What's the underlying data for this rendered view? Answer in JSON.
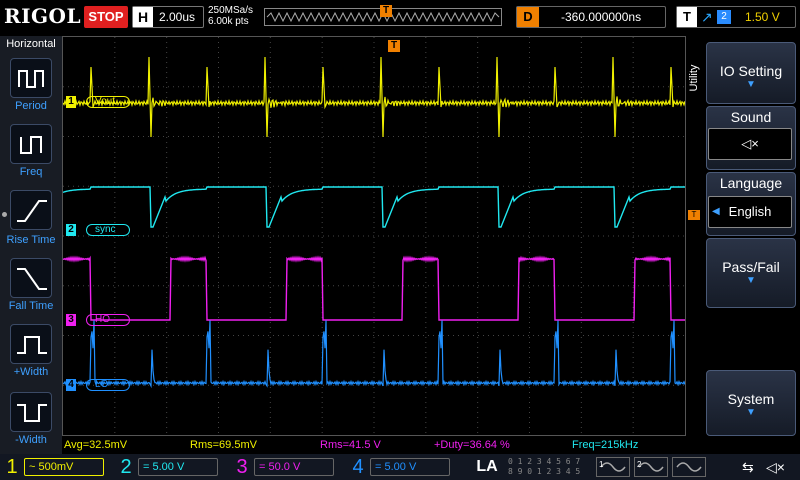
{
  "topbar": {
    "logo": "RIGOL",
    "run_state": "STOP",
    "h_label": "H",
    "timebase": "2.00us",
    "sample_rate": "250MSa/s",
    "memory_depth": "6.00k pts",
    "trigger_marker": "T",
    "delay_label": "D",
    "delay_value": "-360.000000ns",
    "trig_label": "T",
    "trig_source": "2",
    "trig_level": "1.50 V"
  },
  "left_panel": {
    "title": "Horizontal",
    "buttons": [
      {
        "label": "Period",
        "icon": "period-icon"
      },
      {
        "label": "Freq",
        "icon": "freq-icon"
      },
      {
        "label": "Rise Time",
        "icon": "rise-time-icon"
      },
      {
        "label": "Fall Time",
        "icon": "fall-time-icon"
      },
      {
        "label": "+Width",
        "icon": "pos-width-icon"
      },
      {
        "label": "-Width",
        "icon": "neg-width-icon"
      }
    ]
  },
  "channels": [
    {
      "num": "1",
      "name": "Vout",
      "color": "#f0f000",
      "scale": "500mV",
      "coupling": "~"
    },
    {
      "num": "2",
      "name": "sync",
      "color": "#20e8f0",
      "scale": "5.00 V",
      "coupling": "="
    },
    {
      "num": "3",
      "name": "HO",
      "color": "#f020f0",
      "scale": "50.0 V",
      "coupling": "="
    },
    {
      "num": "4",
      "name": "LO",
      "color": "#2090ff",
      "scale": "5.00 V",
      "coupling": "="
    }
  ],
  "utility_tab": "Utility",
  "right_panel": {
    "io_setting": "IO Setting",
    "sound": "Sound",
    "sound_icon": "speaker-mute-icon",
    "language": "Language",
    "language_value": "English",
    "pass_fail": "Pass/Fail",
    "system": "System"
  },
  "measurements": {
    "avg": "Avg=32.5mV",
    "rms": "Rms=69.5mV",
    "rms3": "Rms=41.5 V",
    "duty": "+Duty=36.64 %",
    "freq": "Freq=215kHz"
  },
  "bottombar": {
    "la": "LA",
    "la_digits_top": "0 1 2 3 4 5 6 7",
    "la_digits_bot": "8 9 0 1 2 3 4 5",
    "gen1": "1",
    "gen2": "2"
  },
  "colors": {
    "trigger_orange": "#f08000",
    "accent_blue": "#3ea0ff"
  }
}
